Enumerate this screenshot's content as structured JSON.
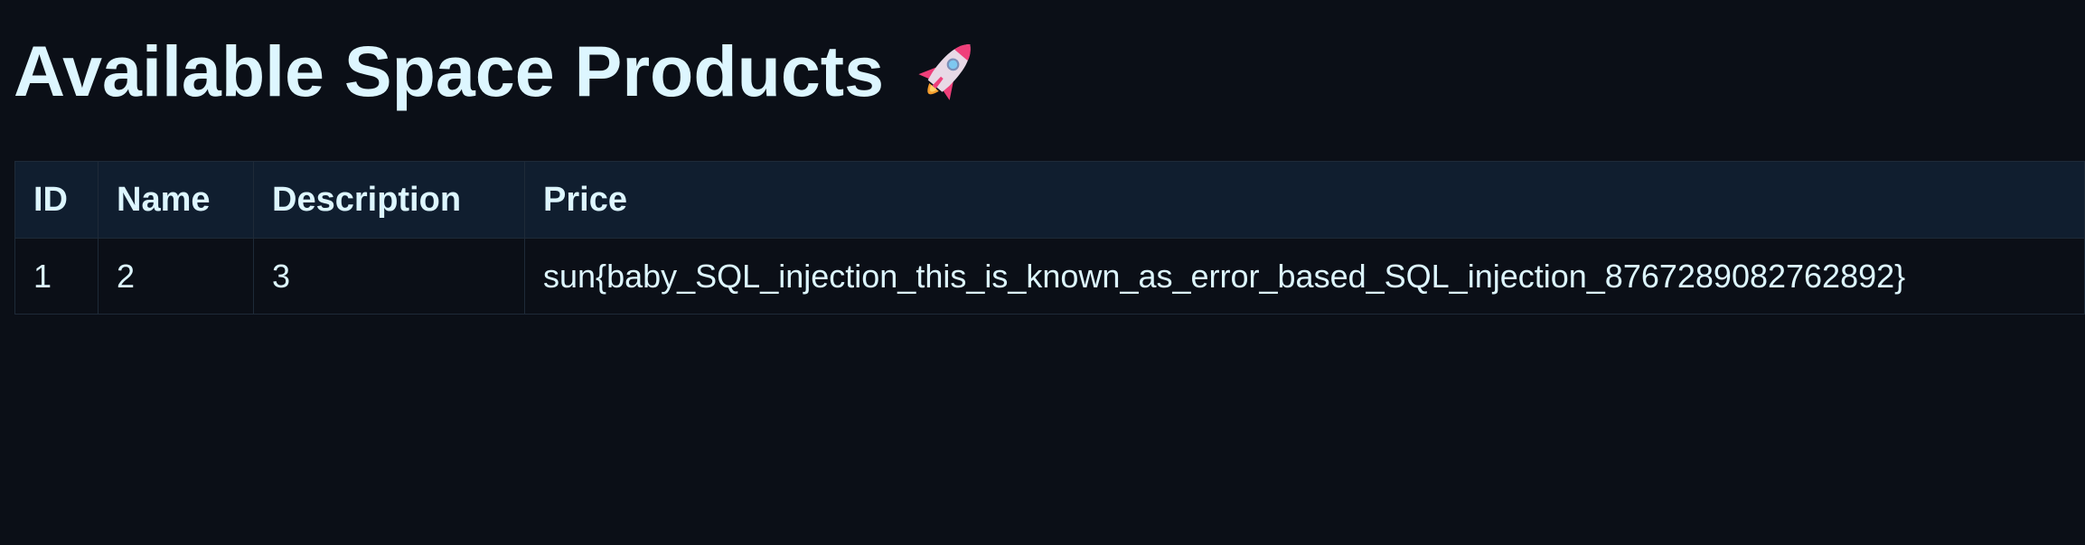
{
  "page": {
    "title": "Available Space Products",
    "title_icon": "rocket-icon"
  },
  "table": {
    "columns": [
      "ID",
      "Name",
      "Description",
      "Price"
    ],
    "rows": [
      {
        "id": "1",
        "name": "2",
        "description": "3",
        "price": "sun{baby_SQL_injection_this_is_known_as_error_based_SQL_injection_8767289082762892}"
      }
    ]
  },
  "colors": {
    "background": "#0b0f17",
    "header_background": "#101e2f",
    "text": "#ddf6ff",
    "border": "#1e2a38"
  }
}
